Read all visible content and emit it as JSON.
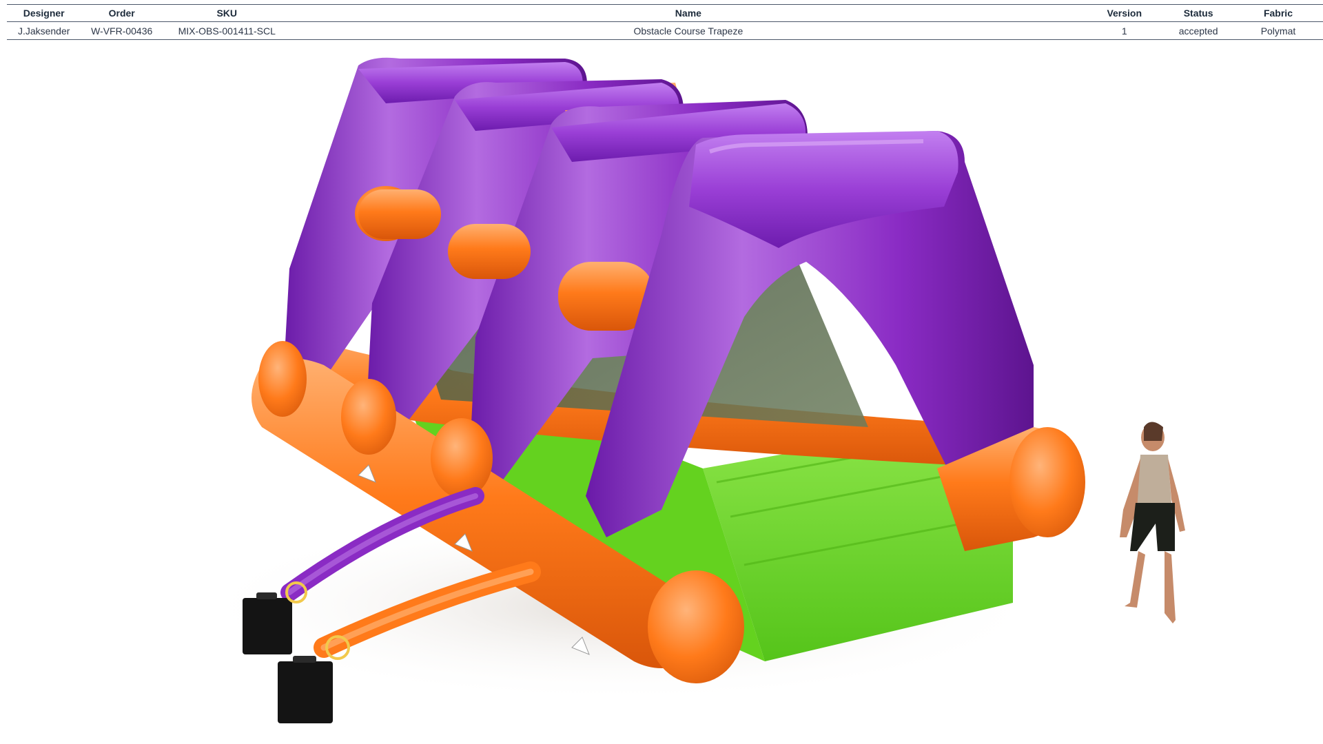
{
  "table": {
    "headers": {
      "designer": "Designer",
      "order": "Order",
      "sku": "SKU",
      "name": "Name",
      "version": "Version",
      "status": "Status",
      "fabric": "Fabric"
    },
    "row": {
      "designer": "J.Jaksender",
      "order": "W-VFR-00436",
      "sku": "MIX-OBS-001411-SCL",
      "name": "Obstacle Course Trapeze",
      "version": "1",
      "status": "accepted",
      "fabric": "Polymat"
    }
  },
  "render": {
    "icons": [
      "inflatable-obstacle-course",
      "blower-icon",
      "human-figure-scale"
    ],
    "colors": {
      "purple": "#8a2bc4",
      "purple_light": "#b36be0",
      "orange": "#ff7a1a",
      "orange_light": "#ffab66",
      "green": "#6fdc2a",
      "blower": "#141414"
    }
  }
}
